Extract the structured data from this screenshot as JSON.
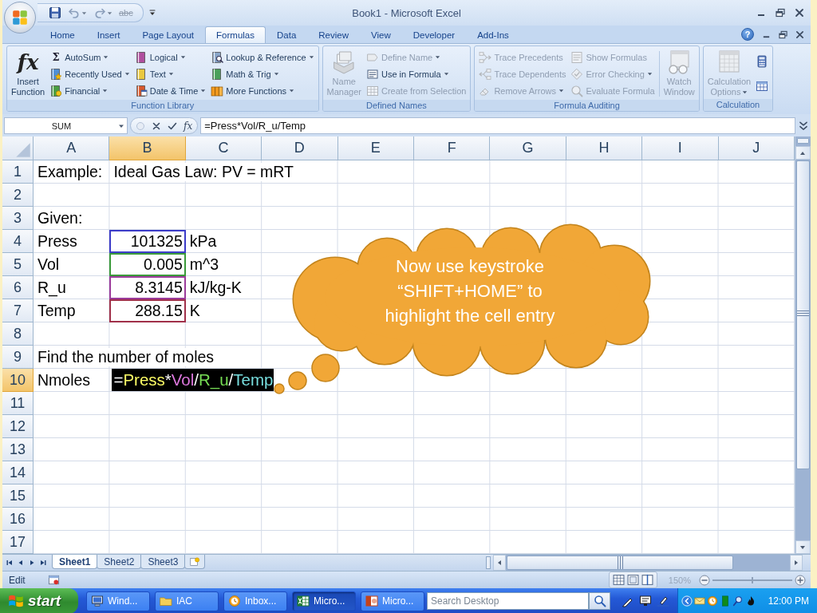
{
  "window": {
    "title": "Book1 - Microsoft Excel"
  },
  "quick_access": [
    {
      "disabled": false
    },
    {
      "disabled": true,
      "menu": true
    },
    {
      "disabled": true,
      "menu": true
    },
    {
      "glyph": "abc",
      "disabled": true
    }
  ],
  "tabs": [
    {
      "label": "Home",
      "selected": false
    },
    {
      "label": "Insert",
      "selected": false
    },
    {
      "label": "Page Layout",
      "selected": false
    },
    {
      "label": "Formulas",
      "selected": true
    },
    {
      "label": "Data",
      "selected": false
    },
    {
      "label": "Review",
      "selected": false
    },
    {
      "label": "View",
      "selected": false
    },
    {
      "label": "Developer",
      "selected": false
    },
    {
      "label": "Add-Ins",
      "selected": false
    }
  ],
  "help": {
    "glyph": "?"
  },
  "ribbon": {
    "groups": [
      {
        "label": "Function Library",
        "items": [
          {
            "kind": "large",
            "label": "Insert Function",
            "glyph": "fx",
            "disabled": false
          },
          {
            "kind": "column",
            "buttons": [
              {
                "label": "AutoSum",
                "glyph": "Σ",
                "menu": true,
                "disabled": false
              },
              {
                "label": "Recently Used",
                "menu": true,
                "disabled": false
              },
              {
                "label": "Financial",
                "menu": true,
                "disabled": false
              }
            ]
          },
          {
            "kind": "column",
            "buttons": [
              {
                "label": "Logical",
                "menu": true,
                "disabled": false
              },
              {
                "label": "Text",
                "menu": true,
                "disabled": false
              },
              {
                "label": "Date & Time",
                "menu": true,
                "disabled": false
              }
            ]
          },
          {
            "kind": "column",
            "buttons": [
              {
                "label": "Lookup & Reference",
                "menu": true,
                "disabled": false
              },
              {
                "label": "Math & Trig",
                "menu": true,
                "disabled": false
              },
              {
                "label": "More Functions",
                "menu": true,
                "disabled": false
              }
            ]
          }
        ]
      },
      {
        "label": "Defined Names",
        "items": [
          {
            "kind": "large",
            "label": "Name Manager",
            "disabled": true
          },
          {
            "kind": "column",
            "buttons": [
              {
                "label": "Define Name",
                "menu": true,
                "disabled": true
              },
              {
                "label": "Use in Formula",
                "menu": true,
                "disabled": false
              },
              {
                "label": "Create from Selection",
                "disabled": true
              }
            ]
          }
        ]
      },
      {
        "label": "Formula Auditing",
        "items": [
          {
            "kind": "column",
            "buttons": [
              {
                "label": "Trace Precedents",
                "disabled": true
              },
              {
                "label": "Trace Dependents",
                "disabled": true
              },
              {
                "label": "Remove Arrows",
                "menu": true,
                "disabled": true
              }
            ]
          },
          {
            "kind": "column",
            "buttons": [
              {
                "label": "Show Formulas",
                "disabled": true
              },
              {
                "label": "Error Checking",
                "menu": true,
                "disabled": true
              },
              {
                "label": "Evaluate Formula",
                "disabled": true
              }
            ]
          },
          {
            "kind": "large",
            "label": "Watch Window",
            "disabled": true
          }
        ]
      },
      {
        "label": "Calculation",
        "items": [
          {
            "kind": "large",
            "label": "Calculation Options",
            "menu": true,
            "disabled": true
          },
          {
            "kind": "column",
            "buttons": [
              {
                "disabled": false
              },
              {
                "disabled": false
              }
            ]
          }
        ]
      }
    ]
  },
  "formula_bar": {
    "name_box": "SUM",
    "glyph": "fx",
    "formula": "=Press*Vol/R_u/Temp"
  },
  "sheet": {
    "columns": [
      {
        "label": "A",
        "selected": false
      },
      {
        "label": "B",
        "selected": true
      },
      {
        "label": "C",
        "selected": false
      },
      {
        "label": "D",
        "selected": false
      },
      {
        "label": "E",
        "selected": false
      },
      {
        "label": "F",
        "selected": false
      },
      {
        "label": "G",
        "selected": false
      },
      {
        "label": "H",
        "selected": false
      },
      {
        "label": "I",
        "selected": false
      },
      {
        "label": "J",
        "selected": false
      }
    ],
    "rows": [
      {
        "label": "1",
        "selected": false,
        "cells": [
          {
            "kind": "text",
            "text": "Example:"
          },
          {
            "kind": "text",
            "text": "Ideal Gas Law: PV = mRT"
          }
        ]
      },
      {
        "label": "2",
        "selected": false
      },
      {
        "label": "3",
        "selected": false,
        "cells": [
          {
            "kind": "text",
            "text": "Given:"
          }
        ]
      },
      {
        "label": "4",
        "selected": false,
        "cells": [
          {
            "kind": "text",
            "text": "Press"
          },
          {
            "kind": "number",
            "text": "101325",
            "color": "#3c3cc8"
          },
          {
            "kind": "text",
            "text": "kPa"
          }
        ]
      },
      {
        "label": "5",
        "selected": false,
        "cells": [
          {
            "kind": "text",
            "text": "Vol"
          },
          {
            "kind": "number",
            "text": "0.005",
            "color": "#3a9a3a"
          },
          {
            "kind": "text",
            "text": "m^3"
          }
        ]
      },
      {
        "label": "6",
        "selected": false,
        "cells": [
          {
            "kind": "text",
            "text": "R_u"
          },
          {
            "kind": "number",
            "text": "8.3145",
            "color": "#9b3b9b"
          },
          {
            "kind": "text",
            "text": "kJ/kg-K"
          }
        ]
      },
      {
        "label": "7",
        "selected": false,
        "cells": [
          {
            "kind": "text",
            "text": "Temp"
          },
          {
            "kind": "number",
            "text": "288.15",
            "color": "#a0304a"
          },
          {
            "kind": "text",
            "text": "K"
          }
        ]
      },
      {
        "label": "8",
        "selected": false
      },
      {
        "label": "9",
        "selected": false,
        "cells": [
          {
            "kind": "text",
            "text": "Find the number of moles"
          }
        ]
      },
      {
        "label": "10",
        "selected": true,
        "cells": [
          {
            "kind": "text",
            "text": "Nmoles"
          },
          {
            "kind": "editing",
            "tokens": [
              {
                "text": "=",
                "color": "#ffffff"
              },
              {
                "text": "Press",
                "color": "#ffff66"
              },
              {
                "text": "*",
                "color": "#ffffff"
              },
              {
                "text": "Vol",
                "color": "#dd77dd"
              },
              {
                "text": "/",
                "color": "#ffffff"
              },
              {
                "text": "R_u",
                "color": "#77dd55"
              },
              {
                "text": "/",
                "color": "#ffffff"
              },
              {
                "text": "Temp",
                "color": "#77dddd"
              }
            ]
          }
        ]
      },
      {
        "label": "11",
        "selected": false
      },
      {
        "label": "12",
        "selected": false
      },
      {
        "label": "13",
        "selected": false
      },
      {
        "label": "14",
        "selected": false
      },
      {
        "label": "15",
        "selected": false
      },
      {
        "label": "16",
        "selected": false
      },
      {
        "label": "17",
        "selected": false
      }
    ]
  },
  "callout": {
    "text": "Now use keystroke “SHIFT+HOME” to highlight the cell entry"
  },
  "sheet_tabs": [
    {
      "label": "Sheet1",
      "selected": true
    },
    {
      "label": "Sheet2",
      "selected": false
    },
    {
      "label": "Sheet3",
      "selected": false
    }
  ],
  "status_bar": {
    "mode": "Edit",
    "zoom": {
      "text": "150%",
      "disabled": true,
      "level": 0.5
    }
  },
  "taskbar": {
    "start": "start",
    "tasks": [
      {
        "label": "Wind...",
        "selected": false
      },
      {
        "label": "IAC",
        "selected": false
      },
      {
        "label": "Inbox...",
        "selected": false
      },
      {
        "label": "Micro...",
        "selected": true
      },
      {
        "label": "Micro...",
        "selected": false
      }
    ],
    "search": {
      "placeholder": "Search Desktop"
    },
    "clock": "12:00 PM"
  }
}
